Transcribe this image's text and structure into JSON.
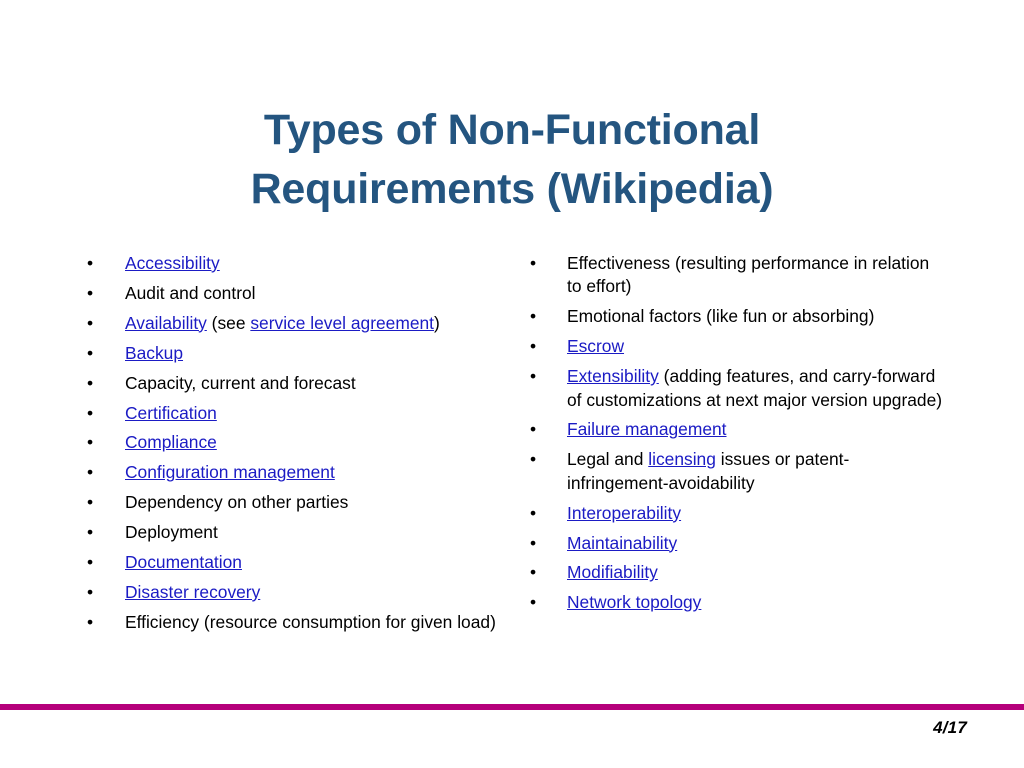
{
  "slide": {
    "title_lines": [
      "Types of Non-Functional",
      "Requirements (Wikipedia)"
    ],
    "title_color": "#245580",
    "link_color": "#1B1BC4",
    "accent_rule_color": "#B5007B",
    "background_color": "#FFFFFF",
    "bullet_glyph": "•"
  },
  "columns": {
    "left": {
      "items": [
        {
          "parts": [
            {
              "text": "Accessibility",
              "link": true
            }
          ]
        },
        {
          "parts": [
            {
              "text": "Audit and control",
              "link": false
            }
          ]
        },
        {
          "parts": [
            {
              "text": "Availability",
              "link": true
            },
            {
              "text": " (see ",
              "link": false
            },
            {
              "text": "service level agreement",
              "link": true
            },
            {
              "text": ")",
              "link": false
            }
          ]
        },
        {
          "parts": [
            {
              "text": "Backup",
              "link": true
            }
          ]
        },
        {
          "parts": [
            {
              "text": "Capacity, current and forecast",
              "link": false
            }
          ]
        },
        {
          "parts": [
            {
              "text": "Certification",
              "link": true
            }
          ]
        },
        {
          "parts": [
            {
              "text": "Compliance",
              "link": true
            }
          ]
        },
        {
          "parts": [
            {
              "text": "Configuration management",
              "link": true
            }
          ]
        },
        {
          "parts": [
            {
              "text": "Dependency on other parties",
              "link": false
            }
          ]
        },
        {
          "parts": [
            {
              "text": "Deployment",
              "link": false
            }
          ]
        },
        {
          "parts": [
            {
              "text": "Documentation",
              "link": true
            }
          ]
        },
        {
          "parts": [
            {
              "text": "Disaster recovery",
              "link": true
            }
          ]
        },
        {
          "parts": [
            {
              "text": "Efficiency (resource consumption for given load)",
              "link": false
            }
          ]
        }
      ]
    },
    "right": {
      "items": [
        {
          "parts": [
            {
              "text": "Effectiveness (resulting performance in relation to effort)",
              "link": false
            }
          ]
        },
        {
          "parts": [
            {
              "text": "Emotional factors (like fun or absorbing)",
              "link": false
            }
          ]
        },
        {
          "parts": [
            {
              "text": "Escrow",
              "link": true
            }
          ]
        },
        {
          "parts": [
            {
              "text": "Extensibility",
              "link": true
            },
            {
              "text": " (adding features, and carry-forward of customizations at next major version upgrade)",
              "link": false
            }
          ]
        },
        {
          "parts": [
            {
              "text": "Failure management",
              "link": true
            }
          ]
        },
        {
          "parts": [
            {
              "text": "Legal and ",
              "link": false
            },
            {
              "text": "licensing",
              "link": true
            },
            {
              "text": " issues or patent-infringement-avoidability",
              "link": false
            }
          ]
        },
        {
          "parts": [
            {
              "text": "Interoperability",
              "link": true
            }
          ]
        },
        {
          "parts": [
            {
              "text": "Maintainability",
              "link": true
            }
          ]
        },
        {
          "parts": [
            {
              "text": "Modifiability",
              "link": true
            }
          ]
        },
        {
          "parts": [
            {
              "text": "Network topology",
              "link": true
            }
          ]
        }
      ]
    }
  },
  "footer": {
    "page_number": "4/17"
  }
}
